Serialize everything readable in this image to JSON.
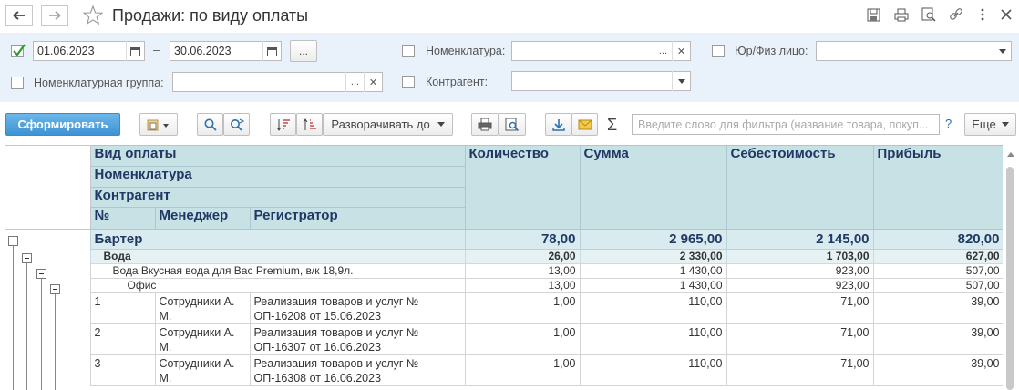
{
  "window": {
    "title": "Продажи: по виду оплаты"
  },
  "filters": {
    "period_enabled": true,
    "date_from": "01.06.2023",
    "date_dash": "–",
    "date_to": "30.06.2023",
    "period_button": "...",
    "nomenclature_group_label": "Номенклатурная группа:",
    "nomenclature_group_value": "",
    "nomenclature_label": "Номенклатура:",
    "nomenclature_value": "",
    "counterparty_label": "Контрагент:",
    "counterparty_value": "",
    "entity_type_label": "Юр/Физ лицо:",
    "entity_type_value": ""
  },
  "toolbar": {
    "generate": "Сформировать",
    "expand_to": "Разворачивать до",
    "sum_symbol": "Σ",
    "filter_placeholder": "Введите слово для фильтра (название товара, покуп...",
    "help": "?",
    "more": "Еще"
  },
  "report": {
    "headers": {
      "payment_type": "Вид оплаты",
      "nomenclature": "Номенклатура",
      "counterparty": "Контрагент",
      "no": "№",
      "manager": "Менеджер",
      "registrar": "Регистратор",
      "quantity": "Количество",
      "sum": "Сумма",
      "cost": "Себестоимость",
      "profit": "Прибыль"
    },
    "group": {
      "label": "Бартер",
      "quantity": "78,00",
      "sum": "2 965,00",
      "cost": "2 145,00",
      "profit": "820,00"
    },
    "subgroup": {
      "label": "Вода",
      "quantity": "26,00",
      "sum": "2 330,00",
      "cost": "1 703,00",
      "profit": "627,00"
    },
    "item": {
      "label": "Вода Вкусная вода для Вас Premium, в/к 18,9л.",
      "quantity": "13,00",
      "sum": "1 430,00",
      "cost": "923,00",
      "profit": "507,00"
    },
    "counterparty": {
      "label": "Офис",
      "quantity": "13,00",
      "sum": "1 430,00",
      "cost": "923,00",
      "profit": "507,00"
    },
    "rows": [
      {
        "no": "1",
        "manager": "Сотрудники А. М.",
        "registrar": "Реализация товаров и услуг № ОП-16208 от 15.06.2023",
        "quantity": "1,00",
        "sum": "110,00",
        "cost": "71,00",
        "profit": "39,00"
      },
      {
        "no": "2",
        "manager": "Сотрудники А. М.",
        "registrar": "Реализация товаров и услуг № ОП-16307 от 16.06.2023",
        "quantity": "1,00",
        "sum": "110,00",
        "cost": "71,00",
        "profit": "39,00"
      },
      {
        "no": "3",
        "manager": "Сотрудники А. М.",
        "registrar": "Реализация товаров и услуг № ОП-16308 от 16.06.2023",
        "quantity": "1,00",
        "sum": "110,00",
        "cost": "71,00",
        "profit": "39,00"
      }
    ]
  }
}
